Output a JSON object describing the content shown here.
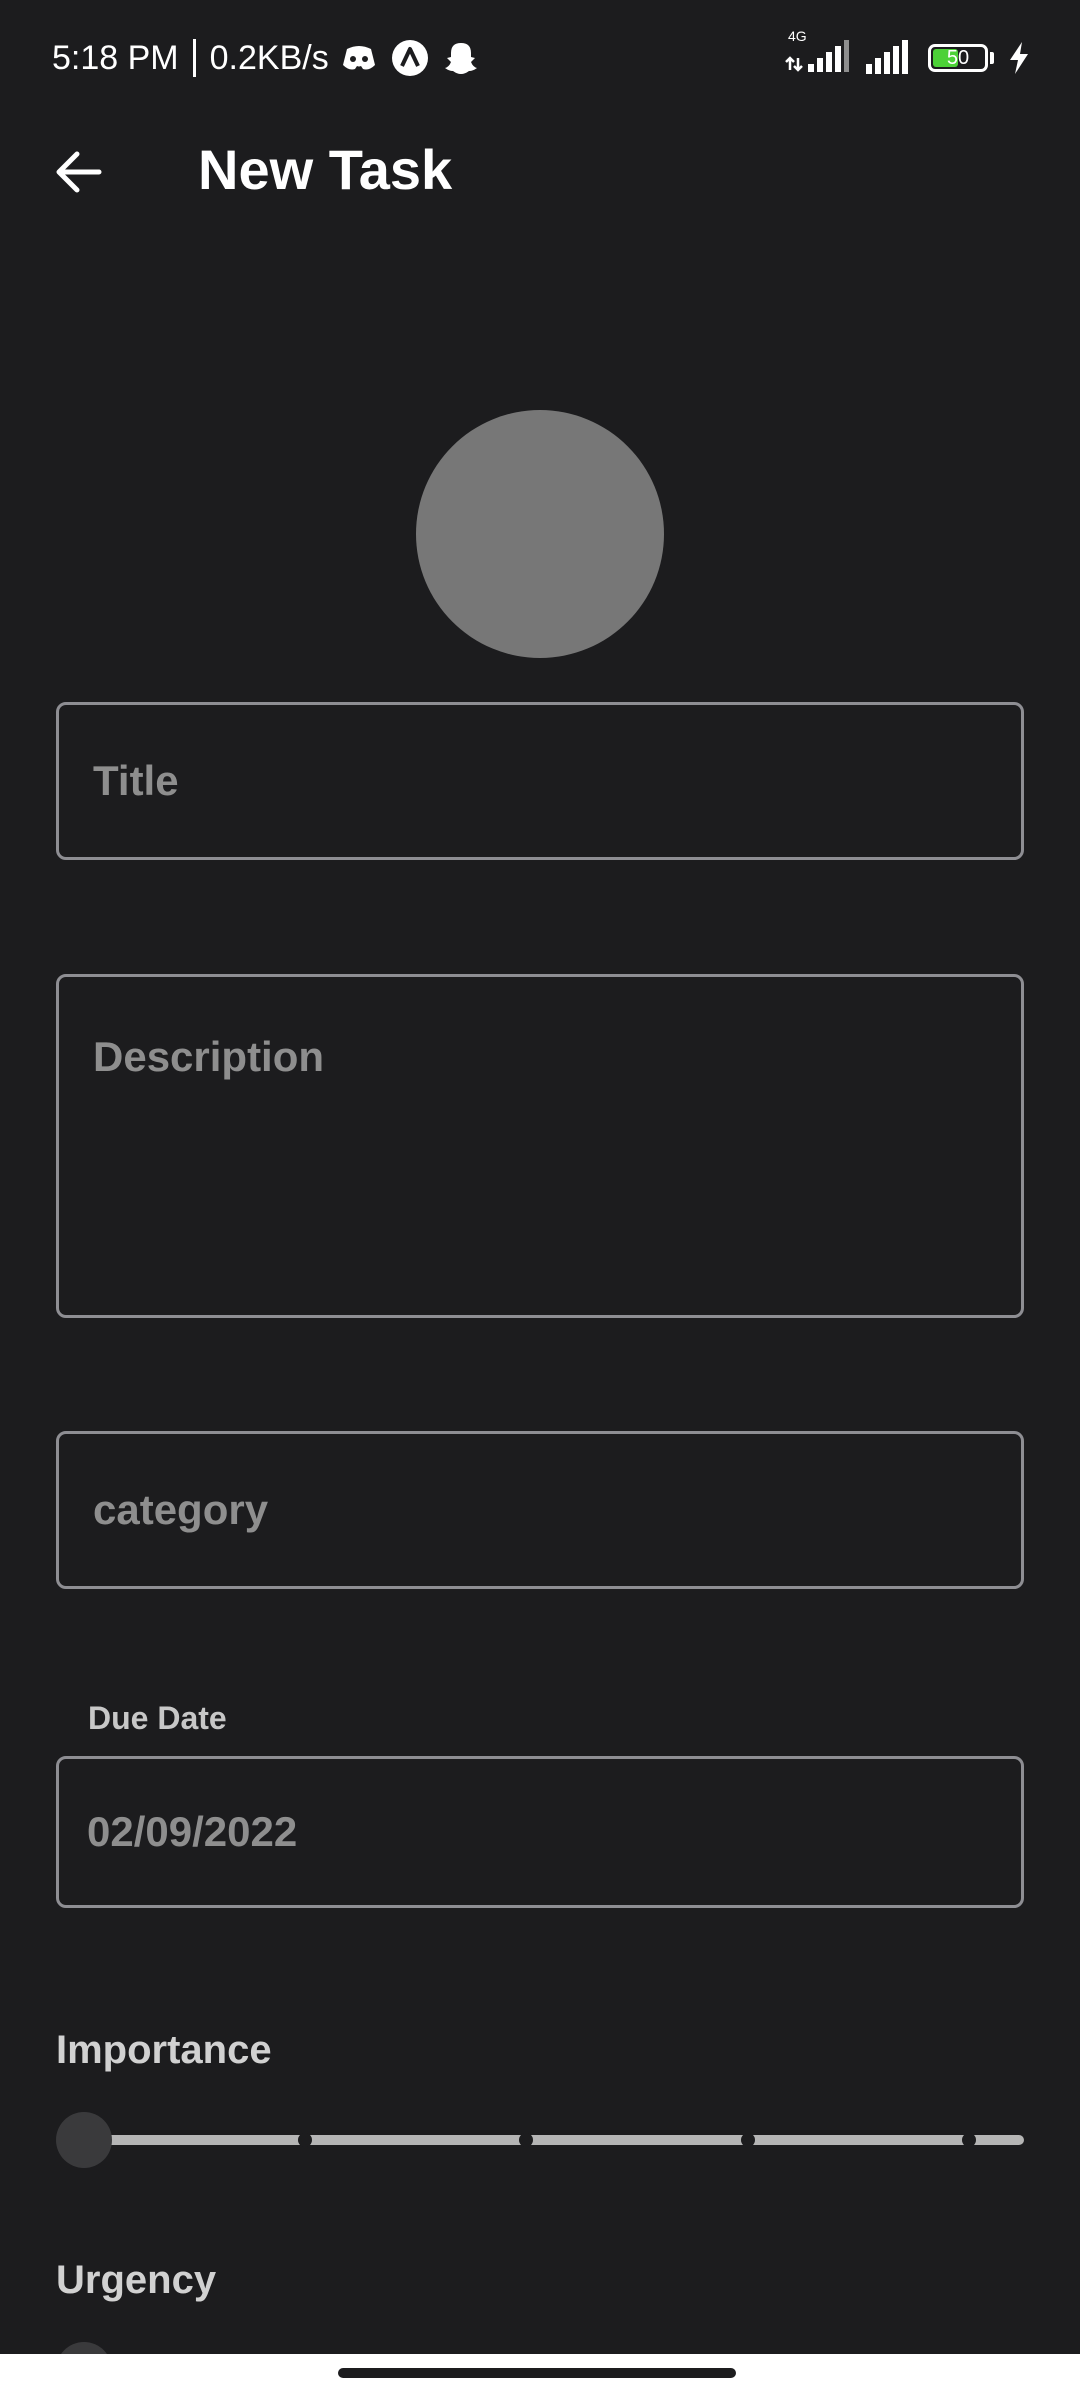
{
  "status_bar": {
    "time": "5:18 PM",
    "net_speed": "0.2KB/s",
    "network_type": "4G",
    "battery_level": "50",
    "battery_fraction": 0.5,
    "battery_color": "#4cd137",
    "icons": [
      "discord-icon",
      "a-app-icon",
      "snapchat-icon",
      "signal-icon",
      "signal-icon",
      "battery-icon",
      "charging-bolt-icon"
    ]
  },
  "app_bar": {
    "back_icon": "arrow-left-icon",
    "title": "New Task"
  },
  "form": {
    "title_placeholder": "Title",
    "description_placeholder": "Description",
    "category_placeholder": "category",
    "due_date_label": "Due Date",
    "due_date_value": "02/09/2022"
  },
  "sliders": {
    "importance": {
      "label": "Importance",
      "value_fraction": 0,
      "divisions": 4
    },
    "urgency": {
      "label": "Urgency",
      "value_fraction": 0,
      "divisions": 4
    }
  },
  "colors": {
    "background": "#1c1c1e",
    "field_border": "#8e8e93",
    "placeholder": "#8e8e8e",
    "avatar": "#777777"
  }
}
